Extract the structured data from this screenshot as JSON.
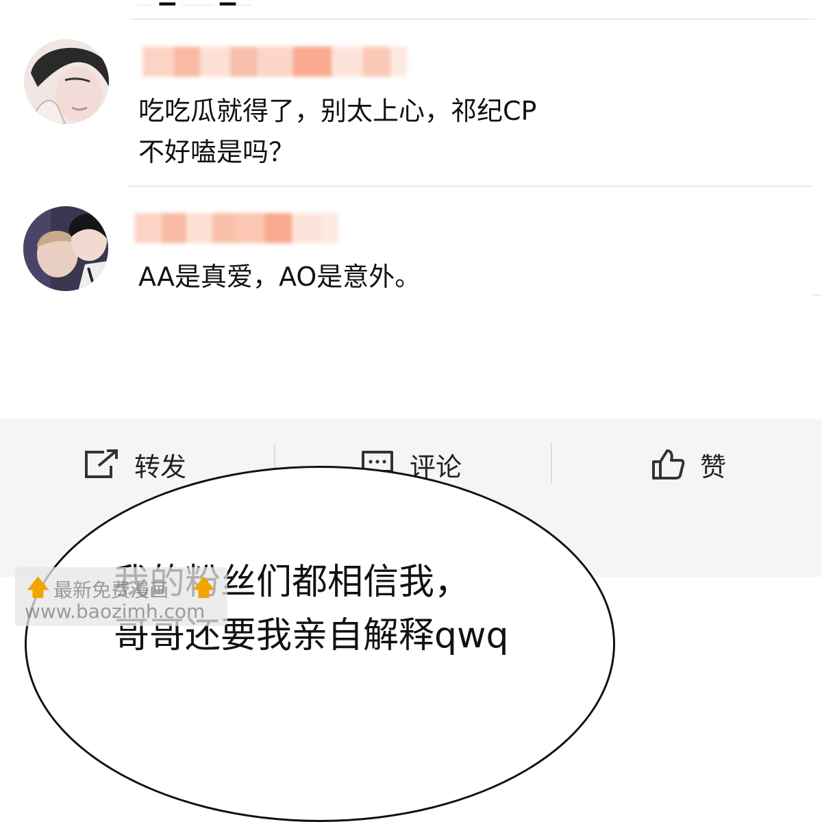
{
  "comments": [
    {
      "username": "",
      "text_line1": "吃吃瓜就得了，别太上心，祁纪CP",
      "text_line2": "不好嗑是吗？"
    },
    {
      "username": "",
      "text_line1": "AA是真爱，AO是意外。"
    }
  ],
  "actions": [
    {
      "icon": "share-icon",
      "label": "转发"
    },
    {
      "icon": "comment-icon",
      "label": "评论"
    },
    {
      "icon": "like-icon",
      "label": "赞"
    }
  ],
  "speech_bubble": {
    "line1": "我的粉丝们都相信我，",
    "line2": "哥哥还要我亲自解释qwq"
  },
  "watermark": {
    "line1": "最新免费漫画",
    "line2": "www.baozimh.com"
  },
  "colors": {
    "blur_pink": "#f9b9a3",
    "action_bar_bg": "#f5f5f5",
    "divider": "#ececec"
  }
}
